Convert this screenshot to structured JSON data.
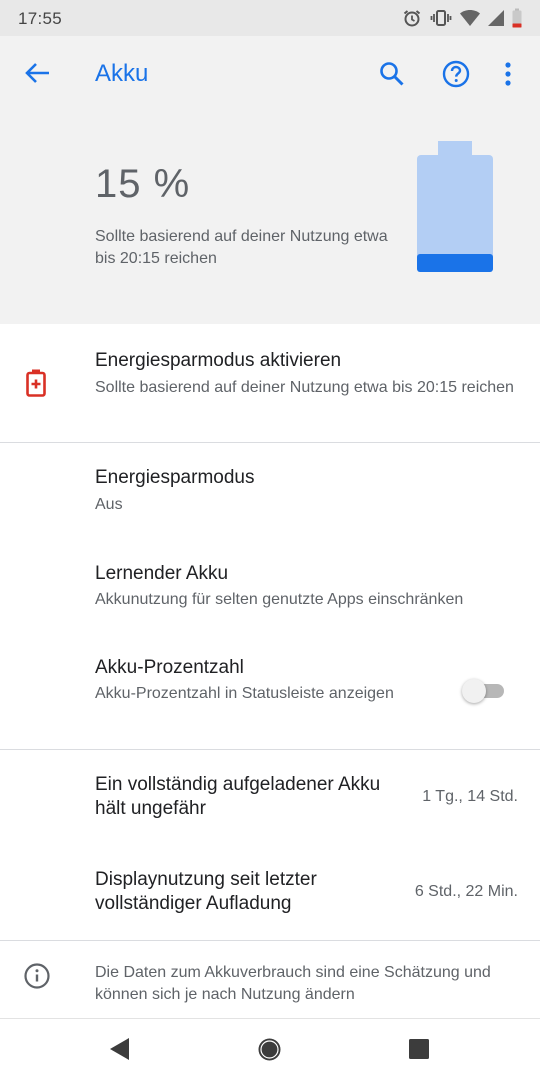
{
  "status_bar": {
    "time": "17:55",
    "icons": [
      "alarm-icon",
      "vibrate-icon",
      "wifi-icon",
      "signal-icon",
      "battery-low-icon"
    ]
  },
  "toolbar": {
    "title": "Akku",
    "back_icon": "arrow-back-icon",
    "actions": [
      "search-icon",
      "help-icon",
      "more-vert-icon"
    ],
    "accent_color": "#1a73e8"
  },
  "battery_header": {
    "percent": "15 %",
    "level": 0.15,
    "estimate": "Sollte basierend auf deiner Nutzung etwa bis 20:15 reichen",
    "battery_color": "#b3cef4",
    "battery_fill_color": "#1a73e8"
  },
  "saver_suggestion": {
    "title": "Energiesparmodus aktivieren",
    "subtitle": "Sollte basierend auf deiner Nutzung etwa bis 20:15 reichen",
    "icon": "battery-alert-icon",
    "icon_color": "#d93025"
  },
  "settings": {
    "battery_saver": {
      "title": "Energiesparmodus",
      "subtitle": "Aus"
    },
    "adaptive_battery": {
      "title": "Lernender Akku",
      "subtitle": "Akkunutzung für selten genutzte Apps einschränken"
    },
    "battery_percentage": {
      "title": "Akku-Prozentzahl",
      "subtitle": "Akku-Prozentzahl in Statusleiste anzeigen",
      "enabled": false
    }
  },
  "usage": {
    "full_charge_lasts": {
      "title": "Ein vollständig aufgeladener Akku hält ungefähr",
      "value": "1 Tg., 14 Std."
    },
    "screen_usage": {
      "title": "Displaynutzung seit letzter vollständiger Aufladung",
      "value": "6 Std., 22 Min."
    }
  },
  "footer": {
    "icon": "info-icon",
    "text": "Die Daten zum Akkuverbrauch sind eine Schätzung und können sich je nach Nutzung ändern"
  },
  "nav_bar": {
    "buttons": [
      "back-nav-icon",
      "home-nav-icon",
      "recents-nav-icon"
    ]
  }
}
